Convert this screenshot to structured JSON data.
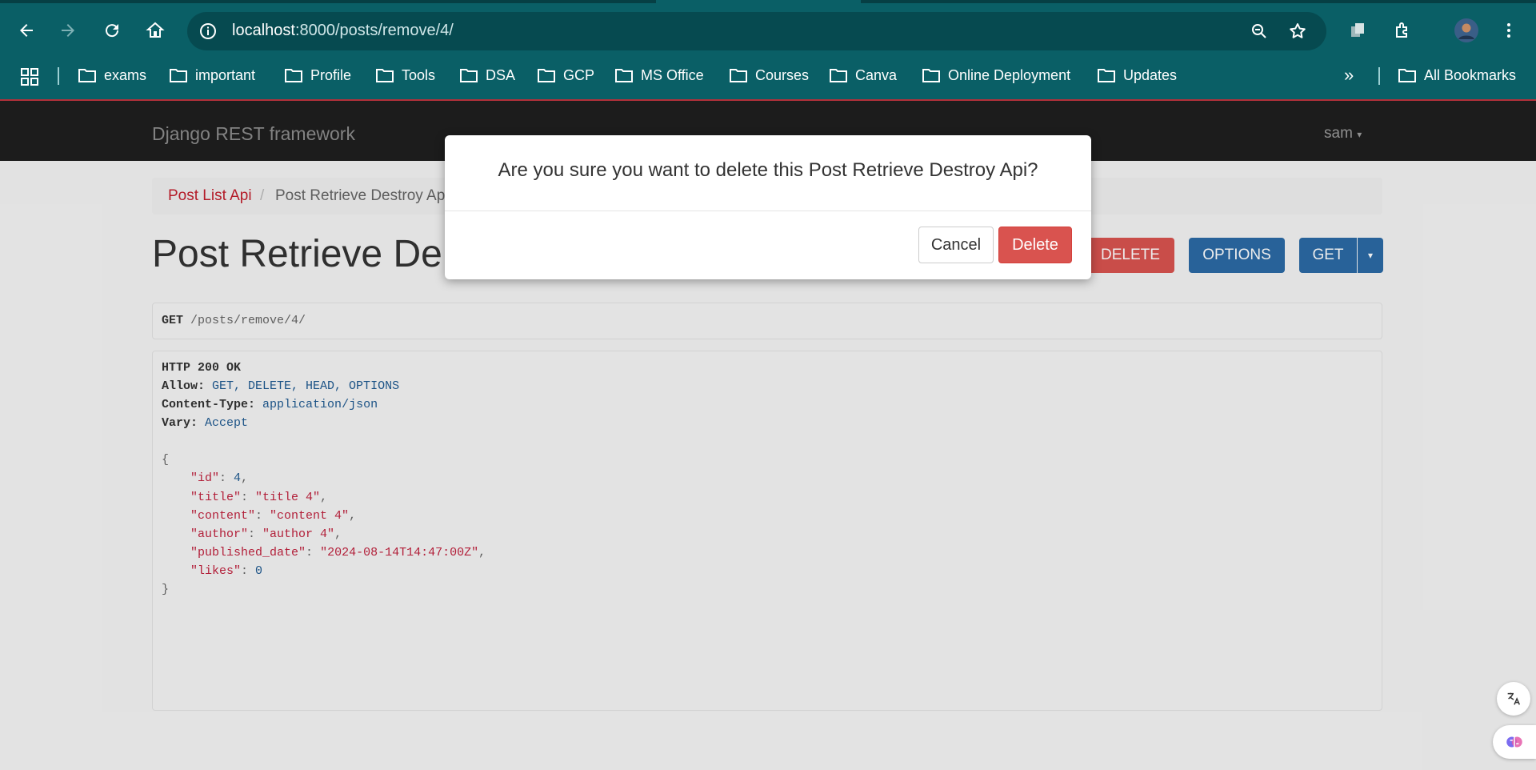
{
  "browser": {
    "url_host": "localhost",
    "url_path": ":8000/posts/remove/4/",
    "bookmarks": [
      "exams",
      "important",
      "Profile",
      "Tools",
      "DSA",
      "GCP",
      "MS Office",
      "Courses",
      "Canva",
      "Online Deployment",
      "Updates"
    ],
    "all_bookmarks": "All Bookmarks",
    "overflow": "»"
  },
  "drf": {
    "brand": "Django REST framework",
    "user": "sam",
    "breadcrumb": [
      "Post List Api",
      "/",
      "Post Retrieve Destroy Ap"
    ],
    "title": "Post Retrieve De",
    "buttons": {
      "delete": "DELETE",
      "options": "OPTIONS",
      "get": "GET"
    },
    "request": {
      "method": "GET",
      "path": "/posts/remove/4/"
    },
    "response": {
      "status": "HTTP 200 OK",
      "allow_label": "Allow:",
      "allow_value": "GET, DELETE, HEAD, OPTIONS",
      "ct_label": "Content-Type:",
      "ct_value": "application/json",
      "vary_label": "Vary:",
      "vary_value": "Accept",
      "body": {
        "id": "4",
        "title": "\"title 4\"",
        "content": "\"content 4\"",
        "author": "\"author 4\"",
        "published_date": "\"2024-08-14T14:47:00Z\"",
        "likes": "0"
      }
    }
  },
  "modal": {
    "question": "Are you sure you want to delete this Post Retrieve Destroy Api?",
    "cancel": "Cancel",
    "delete": "Delete"
  },
  "colors": {
    "chrome": "#0a5f66",
    "danger": "#d9534f",
    "primary": "#2c6aa5",
    "link": "#c21f2d"
  }
}
